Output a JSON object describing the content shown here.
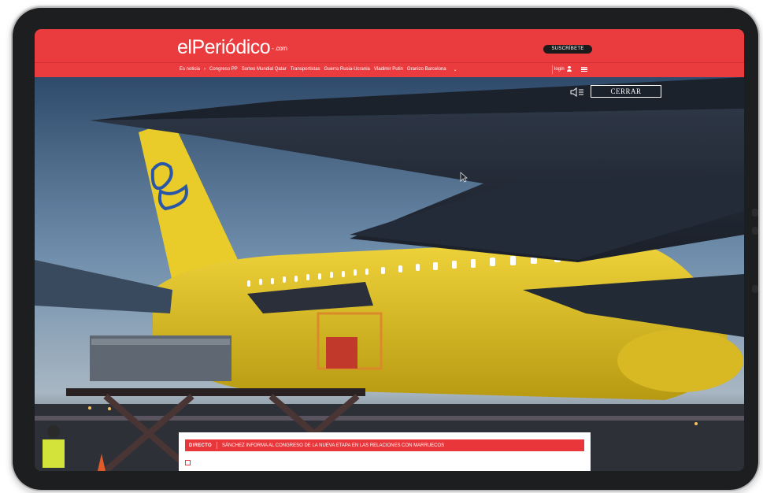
{
  "header": {
    "logo_text": "elPeriódico",
    "logo_suffix": "- .com",
    "subscribe_label": "SUSCRÍBETE"
  },
  "nav": {
    "items": [
      "Es noticia",
      "›",
      "Congreso PP",
      "Sorteo Mundial Qatar",
      "Transportistas",
      "Guerra Rusia-Ucrania",
      "Vladimir Putin",
      "Granizo Barcelona"
    ],
    "login_label": "login"
  },
  "video": {
    "close_label": "CERRAR"
  },
  "news": {
    "tag": "DIRECTO",
    "headline": "SÁNCHEZ INFORMA AL CONGRESO DE LA NUEVA ETAPA EN LAS RELACIONES CON MARRUECOS"
  },
  "colors": {
    "brand_red": "#ea3c3f",
    "bezel": "#1d1e20",
    "plane_yellow": "#e7c92a"
  },
  "icons": [
    "user-icon",
    "menu-icon",
    "sound-icon",
    "cursor-icon",
    "chevron-down-icon"
  ]
}
